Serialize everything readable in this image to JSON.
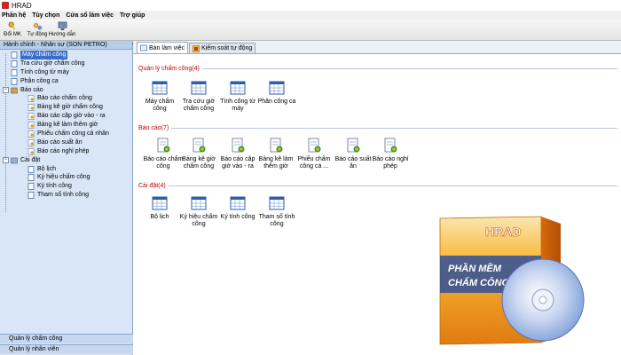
{
  "window": {
    "title": "HRAD"
  },
  "menu": [
    "Phần hệ",
    "Tùy chọn",
    "Cửa sổ làm việc",
    "Trợ giúp"
  ],
  "toolbar": [
    {
      "label": "Đổi MK",
      "icon": "key-icon"
    },
    {
      "label": "Tự động",
      "icon": "gears-icon"
    },
    {
      "label": "Hướng dẫn",
      "icon": "help-screen-icon"
    }
  ],
  "left_panel": {
    "title": "Hành chính - Nhân sự (SON PETRO)",
    "collapse": "<<",
    "tree": {
      "group1": [
        {
          "label": "Máy chấm công",
          "selected": true
        },
        {
          "label": "Tra cứu giờ chấm công"
        },
        {
          "label": "Tính công từ máy"
        },
        {
          "label": "Phân công ca"
        }
      ],
      "reports": {
        "label": "Báo cáo",
        "items": [
          "Báo cáo chấm công",
          "Bảng kê giờ chấm công",
          "Báo cáo cặp giờ vào - ra",
          "Bảng kê làm thêm giờ",
          "Phiếu chấm công cá nhân",
          "Báo cáo suất ăn",
          "Báo cáo nghỉ phép"
        ]
      },
      "settings": {
        "label": "Cài đặt",
        "items": [
          "Bộ lịch",
          "Ký hiệu chấm công",
          "Ký tính công",
          "Tham số tính công"
        ]
      }
    },
    "bottom": [
      "Quản lý chấm công",
      "Quản lý nhân viên"
    ]
  },
  "tabs": [
    {
      "label": "Bàn làm việc",
      "icon": "desk-icon",
      "active": true
    },
    {
      "label": "Kiểm soát tự động",
      "icon": "auto-icon"
    }
  ],
  "sections": {
    "attendance": {
      "title": "Quản lý chấm công(4)",
      "items": [
        "Máy chấm công",
        "Tra cứu giờ chấm công",
        "Tính công từ máy",
        "Phân công ca"
      ]
    },
    "reports": {
      "title": "Báo cáo(7)",
      "items": [
        "Báo cáo chấm công",
        "Bảng kê giờ chấm công",
        "Báo cáo cặp giờ vào - ra",
        "Bảng kê làm thêm giờ",
        "Phiếu chấm công cá ...",
        "Báo cáo suất ăn",
        "Báo cáo nghỉ phép"
      ]
    },
    "settings": {
      "title": "Cài đặt(4)",
      "items": [
        "Bộ lịch",
        "Ký hiệu chấm công",
        "Ký tính công",
        "Tham số tính công"
      ]
    }
  },
  "product": {
    "brand": "HRAD",
    "tagline_1": "PHẦN MỀM",
    "tagline_2": "CHẤM CÔNG"
  },
  "colors": {
    "panel": "#d9e6f7",
    "selection": "#3a6ec8",
    "section_title": "#c00000",
    "box_orange": "#f39c12"
  }
}
